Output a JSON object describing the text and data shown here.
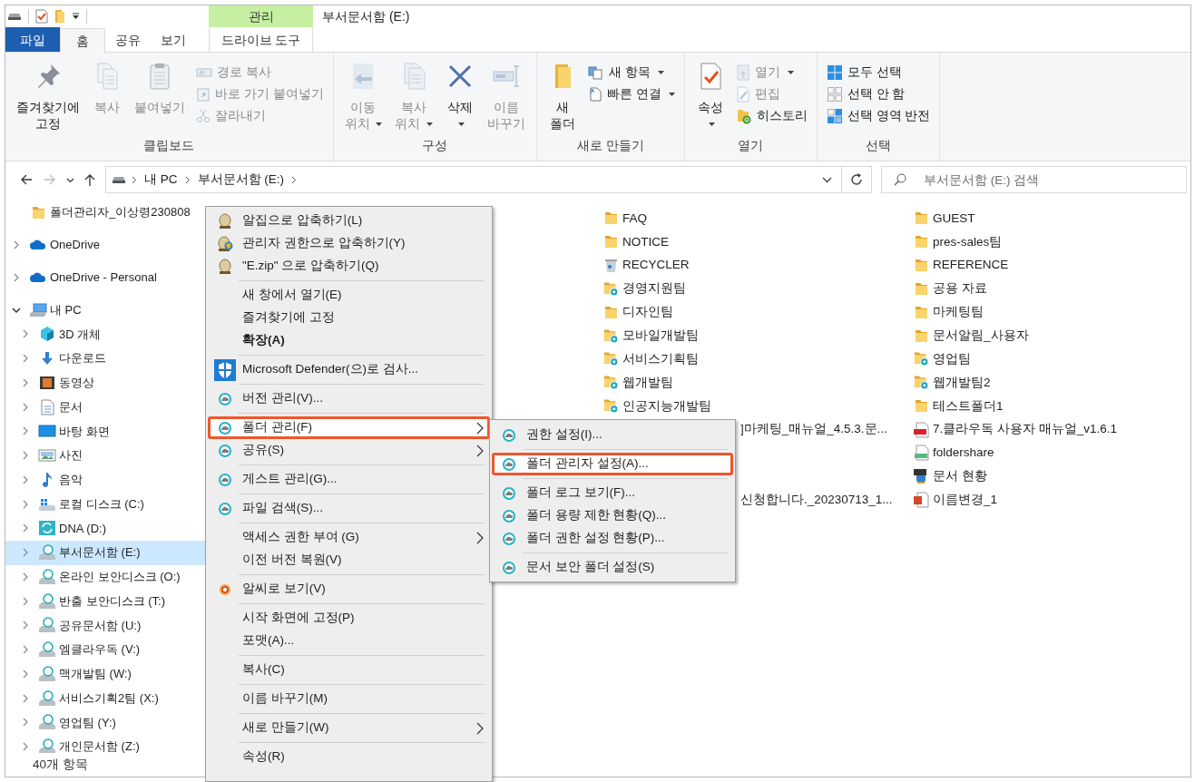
{
  "window": {
    "title": "부서문서함 (E:)"
  },
  "contextual_tab_group": {
    "label": "관리"
  },
  "tabs": [
    {
      "label": "파일",
      "kind": "file",
      "selected": false
    },
    {
      "label": "홈",
      "kind": "tab",
      "selected": true
    },
    {
      "label": "공유",
      "kind": "tab",
      "selected": false
    },
    {
      "label": "보기",
      "kind": "tab",
      "selected": false
    },
    {
      "label": "드라이브 도구",
      "kind": "contextual",
      "selected": false
    }
  ],
  "ribbon": {
    "groups": [
      {
        "label": "클립보드",
        "commands": [
          {
            "kind": "large",
            "lines": [
              "즐겨찾기에",
              "고정"
            ],
            "disabled": false,
            "has_menu": false
          },
          {
            "kind": "large",
            "lines": [
              "복사"
            ],
            "disabled": true,
            "has_menu": false
          },
          {
            "kind": "large",
            "lines": [
              "붙여넣기"
            ],
            "disabled": true,
            "has_menu": false
          },
          {
            "kind": "stack",
            "items": [
              {
                "label": "경로 복사",
                "disabled": true,
                "has_menu": false
              },
              {
                "label": "바로 가기 붙여넣기",
                "disabled": true,
                "has_menu": false
              },
              {
                "label": "잘라내기",
                "disabled": true,
                "has_menu": false
              }
            ]
          }
        ]
      },
      {
        "label": "구성",
        "commands": [
          {
            "kind": "large",
            "lines": [
              "이동",
              "위치"
            ],
            "disabled": true,
            "has_menu": true
          },
          {
            "kind": "large",
            "lines": [
              "복사",
              "위치"
            ],
            "disabled": true,
            "has_menu": true
          },
          {
            "kind": "large",
            "lines": [
              "삭제"
            ],
            "disabled": false,
            "has_menu": true
          },
          {
            "kind": "large",
            "lines": [
              "이름",
              "바꾸기"
            ],
            "disabled": true,
            "has_menu": false
          }
        ]
      },
      {
        "label": "새로 만들기",
        "commands": [
          {
            "kind": "large",
            "lines": [
              "새",
              "폴더"
            ],
            "disabled": false,
            "has_menu": false
          },
          {
            "kind": "stack",
            "items": [
              {
                "label": "새 항목",
                "disabled": false,
                "has_menu": true
              },
              {
                "label": "빠른 연결",
                "disabled": false,
                "has_menu": true
              }
            ]
          }
        ]
      },
      {
        "label": "열기",
        "commands": [
          {
            "kind": "large",
            "lines": [
              "속성"
            ],
            "disabled": false,
            "has_menu": true
          },
          {
            "kind": "stack",
            "items": [
              {
                "label": "열기",
                "disabled": true,
                "has_menu": true
              },
              {
                "label": "편집",
                "disabled": true,
                "has_menu": false
              },
              {
                "label": "히스토리",
                "disabled": false,
                "has_menu": false
              }
            ]
          }
        ]
      },
      {
        "label": "선택",
        "commands": [
          {
            "kind": "stack",
            "items": [
              {
                "label": "모두 선택",
                "disabled": false,
                "has_menu": false
              },
              {
                "label": "선택 안 함",
                "disabled": false,
                "has_menu": false
              },
              {
                "label": "선택 영역 반전",
                "disabled": false,
                "has_menu": false
              }
            ]
          }
        ]
      }
    ]
  },
  "navigation_buttons": [
    {
      "kind": "back",
      "disabled": false
    },
    {
      "kind": "forward",
      "disabled": true
    },
    {
      "kind": "recent",
      "disabled": false
    },
    {
      "kind": "up",
      "disabled": false
    }
  ],
  "address_bar": {
    "path": [
      "내 PC",
      "부서문서함 (E:)"
    ]
  },
  "search": {
    "placeholder": "부서문서함 (E:) 검색"
  },
  "navigation_pane": {
    "items": [
      {
        "label": "폴더관리자_이상령230808",
        "kind": "folder",
        "expandable": false,
        "selected": false
      },
      {
        "label": "OneDrive",
        "kind": "onedrive",
        "expandable": true,
        "expanded": false,
        "selected": false
      },
      {
        "label": "OneDrive - Personal",
        "kind": "onedrive",
        "expandable": true,
        "expanded": false,
        "selected": false
      },
      {
        "label": "내 PC",
        "kind": "pc",
        "expandable": true,
        "expanded": true,
        "selected": false,
        "children": [
          {
            "label": "3D 개체",
            "kind": "cube",
            "expandable": true,
            "expanded": false,
            "selected": false
          },
          {
            "label": "다운로드",
            "kind": "download",
            "expandable": true,
            "expanded": false,
            "selected": false
          },
          {
            "label": "동영상",
            "kind": "video",
            "expandable": true,
            "expanded": false,
            "selected": false
          },
          {
            "label": "문서",
            "kind": "document",
            "expandable": true,
            "expanded": false,
            "selected": false
          },
          {
            "label": "바탕 화면",
            "kind": "desktop",
            "expandable": true,
            "expanded": false,
            "selected": false
          },
          {
            "label": "사진",
            "kind": "picture",
            "expandable": true,
            "expanded": false,
            "selected": false
          },
          {
            "label": "음악",
            "kind": "music",
            "expandable": true,
            "expanded": false,
            "selected": false
          },
          {
            "label": "로컬 디스크 (C:)",
            "kind": "system-drive",
            "expandable": true,
            "expanded": false,
            "selected": false
          },
          {
            "label": "DNA (D:)",
            "kind": "sync-drive",
            "expandable": true,
            "expanded": false,
            "selected": false
          },
          {
            "label": "부서문서함 (E:)",
            "kind": "cloud-drive",
            "expandable": true,
            "expanded": false,
            "selected": true
          },
          {
            "label": "온라인 보안디스크 (O:)",
            "kind": "cloud-drive",
            "expandable": true,
            "expanded": false,
            "selected": false
          },
          {
            "label": "반출 보안디스크 (T:)",
            "kind": "cloud-drive",
            "expandable": true,
            "expanded": false,
            "selected": false
          },
          {
            "label": "공유문서함 (U:)",
            "kind": "cloud-drive",
            "expandable": true,
            "expanded": false,
            "selected": false
          },
          {
            "label": "엠클라우독 (V:)",
            "kind": "cloud-drive",
            "expandable": true,
            "expanded": false,
            "selected": false
          },
          {
            "label": "맥개발팀 (W:)",
            "kind": "cloud-drive",
            "expandable": true,
            "expanded": false,
            "selected": false
          },
          {
            "label": "서비스기획2팀 (X:)",
            "kind": "cloud-drive",
            "expandable": true,
            "expanded": false,
            "selected": false
          },
          {
            "label": "영업팀 (Y:)",
            "kind": "cloud-drive",
            "expandable": true,
            "expanded": false,
            "selected": false
          },
          {
            "label": "개인문서함 (Z:)",
            "kind": "cloud-drive",
            "expandable": true,
            "expanded": false,
            "selected": false
          }
        ]
      }
    ]
  },
  "files": {
    "rows": [
      {
        "column_2": {
          "name": "FAQ",
          "kind": "folder"
        },
        "column_3": {
          "name": "GUEST",
          "kind": "folder"
        }
      },
      {
        "column_2": {
          "name": "NOTICE",
          "kind": "folder"
        },
        "column_3": {
          "name": "pres-sales팀",
          "kind": "folder"
        }
      },
      {
        "column_2": {
          "name": "RECYCLER",
          "kind": "recycler"
        },
        "column_3": {
          "name": "REFERENCE",
          "kind": "folder"
        }
      },
      {
        "column_2": {
          "name": "경영지원팀",
          "kind": "shared-folder"
        },
        "column_3": {
          "name": "공용 자료",
          "kind": "folder"
        }
      },
      {
        "column_2": {
          "name": "디자인팀",
          "kind": "folder"
        },
        "column_3": {
          "name": "마케팅팀",
          "kind": "folder"
        }
      },
      {
        "column_2": {
          "name": "모바일개발팀",
          "kind": "shared-folder"
        },
        "column_3": {
          "name": "문서알림_사용자",
          "kind": "folder"
        }
      },
      {
        "column_2": {
          "name": "서비스기획팀",
          "kind": "shared-folder"
        },
        "column_3": {
          "name": "영업팀",
          "kind": "shared-folder"
        }
      },
      {
        "column_2": {
          "name": "웹개발팀",
          "kind": "shared-folder"
        },
        "column_3": {
          "name": "웹개발팀2",
          "kind": "shared-folder"
        }
      },
      {
        "column_2": {
          "name": "인공지능개발팀",
          "kind": "shared-folder"
        },
        "column_3": {
          "name": "테스트폴더1",
          "kind": "folder"
        }
      },
      {
        "column_2": {
          "name": "]마케팅_매뉴얼_4.5.3.문...",
          "kind": "partial"
        },
        "column_3": {
          "name": "7.클라우독 사용자 매뉴얼_v1.6.1",
          "kind": "pdf"
        }
      },
      {
        "column_3": {
          "name": "foldershare",
          "kind": "image"
        }
      },
      {
        "column_3": {
          "name": "문서 현황",
          "kind": "zip"
        }
      },
      {
        "column_2": {
          "name": "신청합니다._20230713_1...",
          "kind": "partial"
        },
        "column_3": {
          "name": "이름변경_1",
          "kind": "presentation"
        }
      }
    ]
  },
  "context_menu": {
    "groups": [
      [
        {
          "label": "알집으로 압축하기(L)",
          "kind": "alzip",
          "default": false,
          "submenu": false,
          "highlighted": false
        },
        {
          "label": "관리자 권한으로 압축하기(Y)",
          "kind": "alzip-admin",
          "default": false,
          "submenu": false,
          "highlighted": false
        },
        {
          "label": "\"E.zip\" 으로 압축하기(Q)",
          "kind": "alzip",
          "default": false,
          "submenu": false,
          "highlighted": false
        }
      ],
      [
        {
          "label": "새 창에서 열기(E)",
          "kind": "none",
          "default": false,
          "submenu": false,
          "highlighted": false
        },
        {
          "label": "즐겨찾기에 고정",
          "kind": "none",
          "default": false,
          "submenu": false,
          "highlighted": false
        },
        {
          "label": "확장(A)",
          "kind": "none",
          "default": true,
          "submenu": false,
          "highlighted": false
        }
      ],
      [
        {
          "label": "Microsoft Defender(으)로 검사...",
          "kind": "defender",
          "default": false,
          "submenu": false,
          "highlighted": false
        }
      ],
      [
        {
          "label": "버전 관리(V)...",
          "kind": "cloudoc",
          "default": false,
          "submenu": false,
          "highlighted": false
        }
      ],
      [
        {
          "label": "폴더 관리(F)",
          "kind": "cloudoc",
          "default": false,
          "submenu": true,
          "highlighted": true
        },
        {
          "label": "공유(S)",
          "kind": "cloudoc",
          "default": false,
          "submenu": true,
          "highlighted": false
        }
      ],
      [
        {
          "label": "게스트 관리(G)...",
          "kind": "cloudoc",
          "default": false,
          "submenu": false,
          "highlighted": false
        }
      ],
      [
        {
          "label": "파일 검색(S)...",
          "kind": "cloudoc",
          "default": false,
          "submenu": false,
          "highlighted": false
        }
      ],
      [
        {
          "label": "액세스 권한 부여 (G)",
          "kind": "none",
          "default": false,
          "submenu": true,
          "highlighted": false
        },
        {
          "label": "이전 버전 복원(V)",
          "kind": "none",
          "default": false,
          "submenu": false,
          "highlighted": false
        }
      ],
      [
        {
          "label": "알씨로 보기(V)",
          "kind": "alsee",
          "default": false,
          "submenu": false,
          "highlighted": false
        }
      ],
      [
        {
          "label": "시작 화면에 고정(P)",
          "kind": "none",
          "default": false,
          "submenu": false,
          "highlighted": false
        },
        {
          "label": "포맷(A)...",
          "kind": "none",
          "default": false,
          "submenu": false,
          "highlighted": false
        }
      ],
      [
        {
          "label": "복사(C)",
          "kind": "none",
          "default": false,
          "submenu": false,
          "highlighted": false
        }
      ],
      [
        {
          "label": "이름 바꾸기(M)",
          "kind": "none",
          "default": false,
          "submenu": false,
          "highlighted": false
        }
      ],
      [
        {
          "label": "새로 만들기(W)",
          "kind": "none",
          "default": false,
          "submenu": true,
          "highlighted": false
        }
      ],
      [
        {
          "label": "속성(R)",
          "kind": "none",
          "default": false,
          "submenu": false,
          "highlighted": false
        }
      ]
    ]
  },
  "submenu": {
    "groups": [
      [
        {
          "label": "권한 설정(I)...",
          "kind": "cloudoc",
          "default": false,
          "submenu": false,
          "highlighted": false
        }
      ],
      [
        {
          "label": "폴더 관리자 설정(A)...",
          "kind": "cloudoc",
          "default": false,
          "submenu": false,
          "highlighted": true
        }
      ],
      [
        {
          "label": "폴더 로그 보기(F)...",
          "kind": "cloudoc",
          "default": false,
          "submenu": false,
          "highlighted": false
        },
        {
          "label": "폴더 용량 제한 현황(Q)...",
          "kind": "cloudoc",
          "default": false,
          "submenu": false,
          "highlighted": false
        },
        {
          "label": "폴더 권한 설정 현황(P)...",
          "kind": "cloudoc",
          "default": false,
          "submenu": false,
          "highlighted": false
        }
      ],
      [
        {
          "label": "문서 보안 폴더 설정(S)",
          "kind": "cloudoc",
          "default": false,
          "submenu": false,
          "highlighted": false
        }
      ]
    ]
  },
  "status_bar": {
    "item_count": "40개 항목"
  }
}
